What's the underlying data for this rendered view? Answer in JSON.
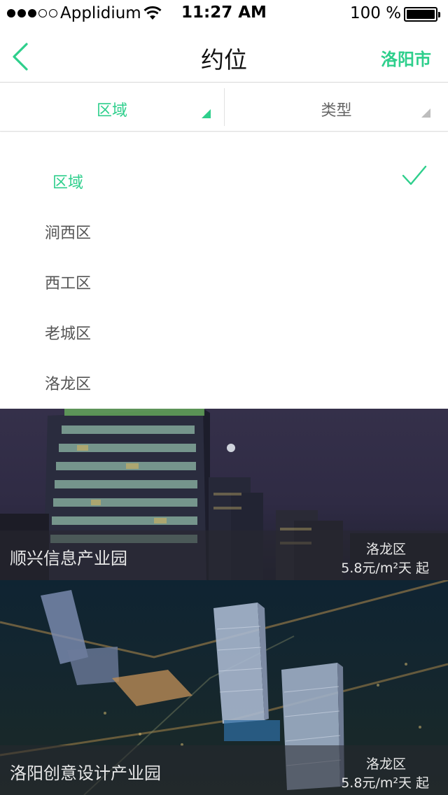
{
  "status_bar": {
    "carrier": "Applidium",
    "time": "11:27 AM",
    "battery": "100 %",
    "signal_bars_filled": 3,
    "signal_bars_total": 5,
    "icons": [
      "signal-icon",
      "wifi-icon",
      "battery-icon"
    ]
  },
  "nav": {
    "title": "约位",
    "city": "洛阳市",
    "back_icon": "chevron-left-icon"
  },
  "filters": {
    "tabs": [
      {
        "label": "区域",
        "active": true
      },
      {
        "label": "类型",
        "active": false
      }
    ]
  },
  "dropdown": {
    "options": [
      {
        "label": "区域",
        "selected": true
      },
      {
        "label": "涧西区",
        "selected": false
      },
      {
        "label": "西工区",
        "selected": false
      },
      {
        "label": "老城区",
        "selected": false
      },
      {
        "label": "洛龙区",
        "selected": false
      }
    ]
  },
  "parks": [
    {
      "name": "顺兴信息产业园",
      "district": "洛龙区",
      "price": "5.8元/m²天 起"
    },
    {
      "name": "洛阳创意设计产业园",
      "district": "洛龙区",
      "price": "5.8元/m²天 起"
    }
  ],
  "colors": {
    "accent": "#2ecf8c",
    "text_secondary": "#555555",
    "caption_overlay": "rgba(40,40,48,0.55)"
  }
}
